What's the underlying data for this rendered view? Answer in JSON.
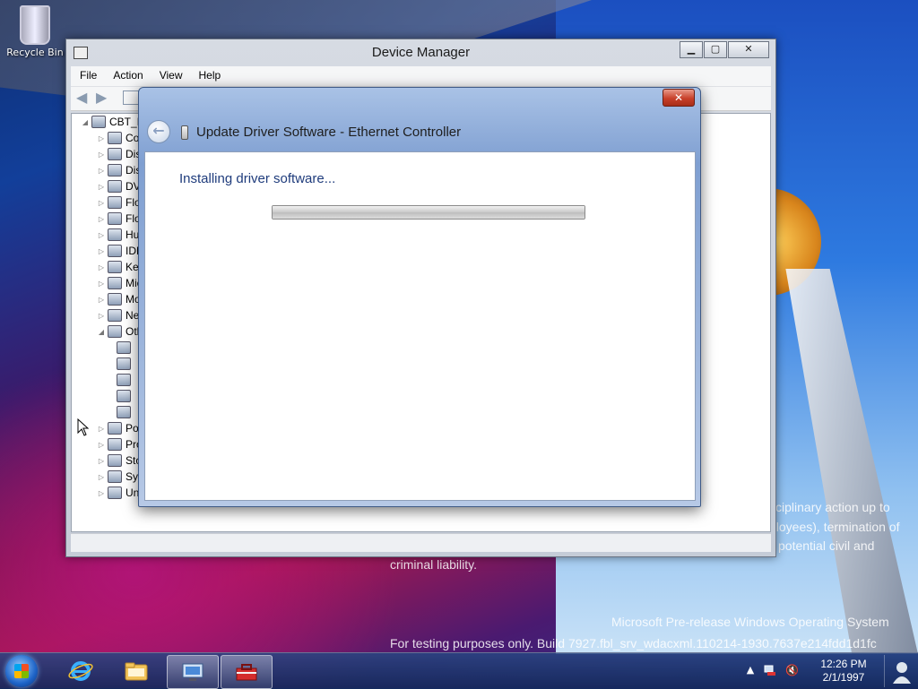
{
  "desktop": {
    "recycle_bin_label": "Recycle Bin",
    "watermark_line1": "sciplinary action up to",
    "watermark_line2": "ployees), termination of",
    "watermark_line3": "potential civil and",
    "watermark_line4": "criminal liability.",
    "os_line1": "Microsoft Pre-release Windows Operating System",
    "os_line2": "For testing purposes only. Build 7927.fbl_srv_wdacxml.110214-1930.7637e214fdd1d1fc"
  },
  "device_manager": {
    "title": "Device Manager",
    "minimize": "▁",
    "maximize": "▢",
    "close": "✕",
    "menu": [
      "File",
      "Action",
      "View",
      "Help"
    ],
    "tree": [
      {
        "label": "CBT_I",
        "expand": "◢"
      },
      {
        "label": "Co",
        "expand": "▷"
      },
      {
        "label": "Dis",
        "expand": "▷"
      },
      {
        "label": "Dis",
        "expand": "▷"
      },
      {
        "label": "DVD",
        "expand": "▷"
      },
      {
        "label": "Flo",
        "expand": "▷"
      },
      {
        "label": "Flo",
        "expand": "▷"
      },
      {
        "label": "Hu",
        "expand": "▷"
      },
      {
        "label": "IDE",
        "expand": "▷"
      },
      {
        "label": "Key",
        "expand": "▷"
      },
      {
        "label": "Mic",
        "expand": "▷"
      },
      {
        "label": "Mo",
        "expand": "▷"
      },
      {
        "label": "Net",
        "expand": "▷"
      },
      {
        "label": "Oth",
        "expand": "◢"
      },
      {
        "label": "",
        "expand": ""
      },
      {
        "label": "",
        "expand": ""
      },
      {
        "label": "",
        "expand": ""
      },
      {
        "label": "",
        "expand": ""
      },
      {
        "label": "",
        "expand": ""
      },
      {
        "label": "Por",
        "expand": "▷"
      },
      {
        "label": "Pro",
        "expand": "▷"
      },
      {
        "label": "Sto",
        "expand": "▷"
      },
      {
        "label": "Sys",
        "expand": "▷"
      },
      {
        "label": "Uni",
        "expand": "▷"
      }
    ]
  },
  "update_dialog": {
    "title": "Update Driver Software - Ethernet Controller",
    "close": "✕",
    "back": "←",
    "status": "Installing driver software...",
    "progress": 1.0
  },
  "taskbar": {
    "time": "12:26 PM",
    "date": "2/1/1997",
    "tray_arrow": "▲",
    "volume_icon": "🔇"
  }
}
